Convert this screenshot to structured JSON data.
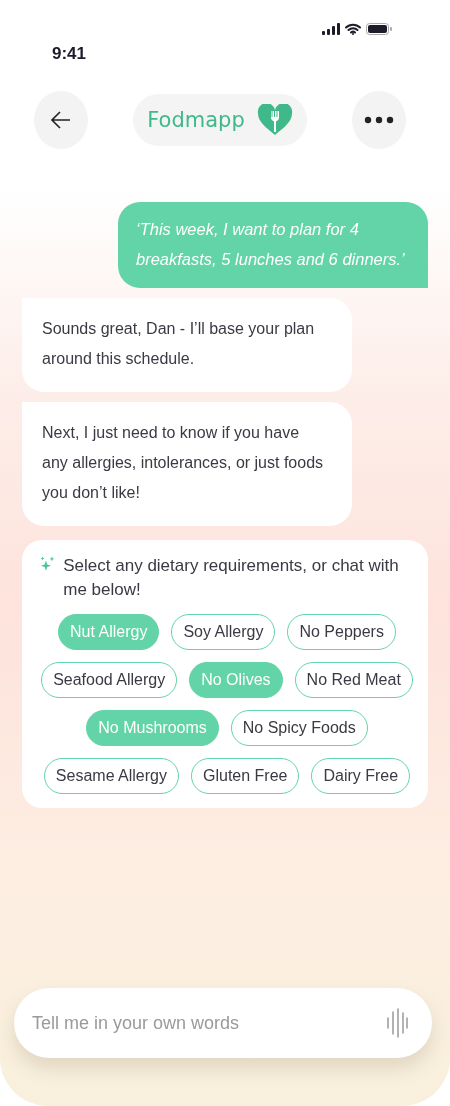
{
  "status_bar": {
    "time": "9:41"
  },
  "header": {
    "title": "Fodmapp"
  },
  "messages": [
    {
      "kind": "user",
      "text": "‘This week, I want to plan for 4 breakfasts, 5 lunches and 6 dinners.’"
    },
    {
      "kind": "bot",
      "text": "Sounds great, Dan - I’ll base your plan around this schedule."
    },
    {
      "kind": "bot",
      "text": "Next, I just need to know if you have any allergies, intolerances, or just foods you don’t like!"
    }
  ],
  "requirements": {
    "prompt": "Select any dietary requirements, or chat with me below!",
    "chip_rows": [
      [
        {
          "label": "Nut Allergy",
          "selected": true
        },
        {
          "label": "Soy Allergy",
          "selected": false
        },
        {
          "label": "No Peppers",
          "selected": false
        }
      ],
      [
        {
          "label": "Seafood Allergy",
          "selected": false
        },
        {
          "label": "No Olives",
          "selected": true
        },
        {
          "label": "No Red Meat",
          "selected": false
        }
      ],
      [
        {
          "label": "No Mushrooms",
          "selected": true
        },
        {
          "label": "No Spicy Foods",
          "selected": false
        }
      ],
      [
        {
          "label": "Sesame Allergy",
          "selected": false
        },
        {
          "label": "Gluten Free",
          "selected": false
        },
        {
          "label": "Dairy Free",
          "selected": false
        }
      ]
    ]
  },
  "input": {
    "placeholder": "Tell me in your own words"
  }
}
